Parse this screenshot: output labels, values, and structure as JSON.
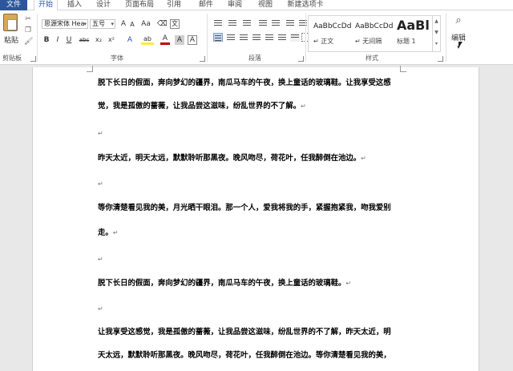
{
  "tabs": {
    "file": "文件",
    "home": "开始",
    "insert": "插入",
    "design": "设计",
    "layout": "页面布局",
    "references": "引用",
    "mailings": "邮件",
    "review": "审阅",
    "view": "视图",
    "addins": "新建选项卡"
  },
  "clipboard": {
    "paste": "粘贴",
    "group": "剪贴板"
  },
  "font": {
    "name": "思源宋体 Hea",
    "size": "五号",
    "group": "字体",
    "grow": "A",
    "shrink": "A",
    "case": "Aa",
    "bold": "B",
    "italic": "I",
    "underline": "U",
    "strike": "abc",
    "sub": "x₂",
    "sup": "x²",
    "effects": "A",
    "highlight": "ab",
    "color": "A",
    "border": "A"
  },
  "paragraph": {
    "group": "段落"
  },
  "styles": {
    "group": "样式",
    "items": [
      {
        "sample": "AaBbCcDd",
        "name": "↵ 正文"
      },
      {
        "sample": "AaBbCcDd",
        "name": "↵ 无间隔"
      },
      {
        "sample": "AaBl",
        "name": "标题 1"
      }
    ]
  },
  "editing": {
    "label": "编辑"
  },
  "document": {
    "lines": [
      "脱下长日的假面，奔向梦幻的疆界，南瓜马车的午夜，换上童话的玻璃鞋。让我享受这感",
      "觉，我是孤傲的蔷薇，让我品尝这滋味，纷乱世界的不了解。",
      "昨天太近，明天太远，默默聆听那黑夜。晚风吻尽，荷花叶，任我醉倒在池边。",
      "等你清楚看见我的美，月光晒干眼泪。那一个人，爱我将我的手，紧握抱紧我，吻我爱别",
      "走。",
      "脱下长日的假面，奔向梦幻的疆界，南瓜马车的午夜，换上童话的玻璃鞋。",
      "让我享受这感觉，我是孤傲的蔷薇，让我品尝这滋味，纷乱世界的不了解，昨天太近，明",
      "天太远，默默聆听那黑夜。晚风吻尽，荷花叶，任我醉倒在池边。等你清楚看见我的美，"
    ],
    "mark": "↵"
  }
}
